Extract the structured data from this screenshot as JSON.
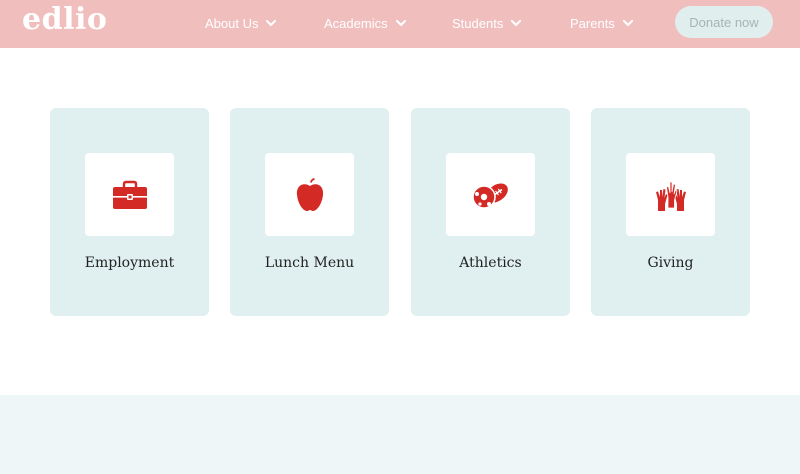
{
  "header": {
    "logo": "edlio",
    "nav": [
      {
        "label": "About Us"
      },
      {
        "label": "Academics"
      },
      {
        "label": "Students"
      },
      {
        "label": "Parents"
      }
    ],
    "donate_label": "Donate now"
  },
  "cards": [
    {
      "label": "Employment",
      "icon": "briefcase-icon"
    },
    {
      "label": "Lunch Menu",
      "icon": "apple-icon"
    },
    {
      "label": "Athletics",
      "icon": "sports-balls-icon"
    },
    {
      "label": "Giving",
      "icon": "raised-hands-icon"
    }
  ],
  "colors": {
    "header_bg": "#f1bebe",
    "card_bg": "#e0f0f0",
    "icon_red": "#d42a26",
    "footer_bg": "#eff6f7"
  }
}
